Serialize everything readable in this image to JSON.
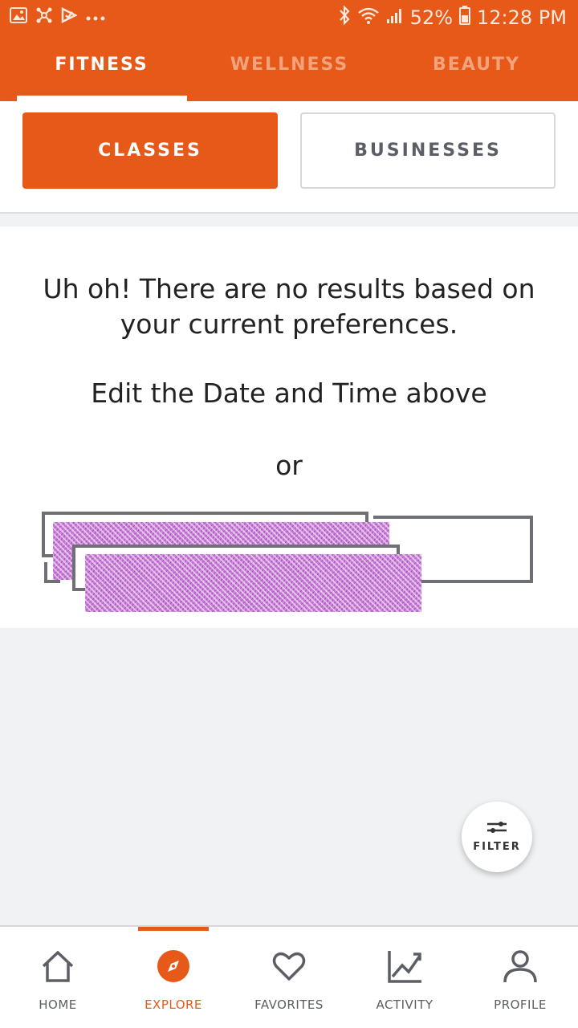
{
  "status_bar": {
    "battery": "52%",
    "time": "12:28 PM",
    "icons": [
      "image-icon",
      "network-icon",
      "check-icon",
      "more-icon",
      "bluetooth-icon",
      "wifi-icon",
      "signal-icon",
      "battery-icon"
    ]
  },
  "top_tabs": [
    {
      "label": "FITNESS",
      "active": true
    },
    {
      "label": "WELLNESS",
      "active": false
    },
    {
      "label": "BEAUTY",
      "active": false
    }
  ],
  "segment": {
    "classes": "CLASSES",
    "businesses": "BUSINESSES",
    "selected": "CLASSES"
  },
  "empty_state": {
    "line1": "Uh oh! There are no results based on your current preferences.",
    "line2": "Edit the Date and Time above",
    "line3": "or"
  },
  "fab": {
    "label": "FILTER",
    "icon": "sliders-icon"
  },
  "bottom_nav": [
    {
      "label": "HOME",
      "icon": "home-icon",
      "active": false
    },
    {
      "label": "EXPLORE",
      "icon": "compass-icon",
      "active": true
    },
    {
      "label": "FAVORITES",
      "icon": "heart-icon",
      "active": false
    },
    {
      "label": "ACTIVITY",
      "icon": "chart-icon",
      "active": false
    },
    {
      "label": "PROFILE",
      "icon": "user-icon",
      "active": false
    }
  ],
  "colors": {
    "accent": "#e65918",
    "text": "#222222",
    "muted": "#5c5e66",
    "background": "#f1f2f4"
  }
}
